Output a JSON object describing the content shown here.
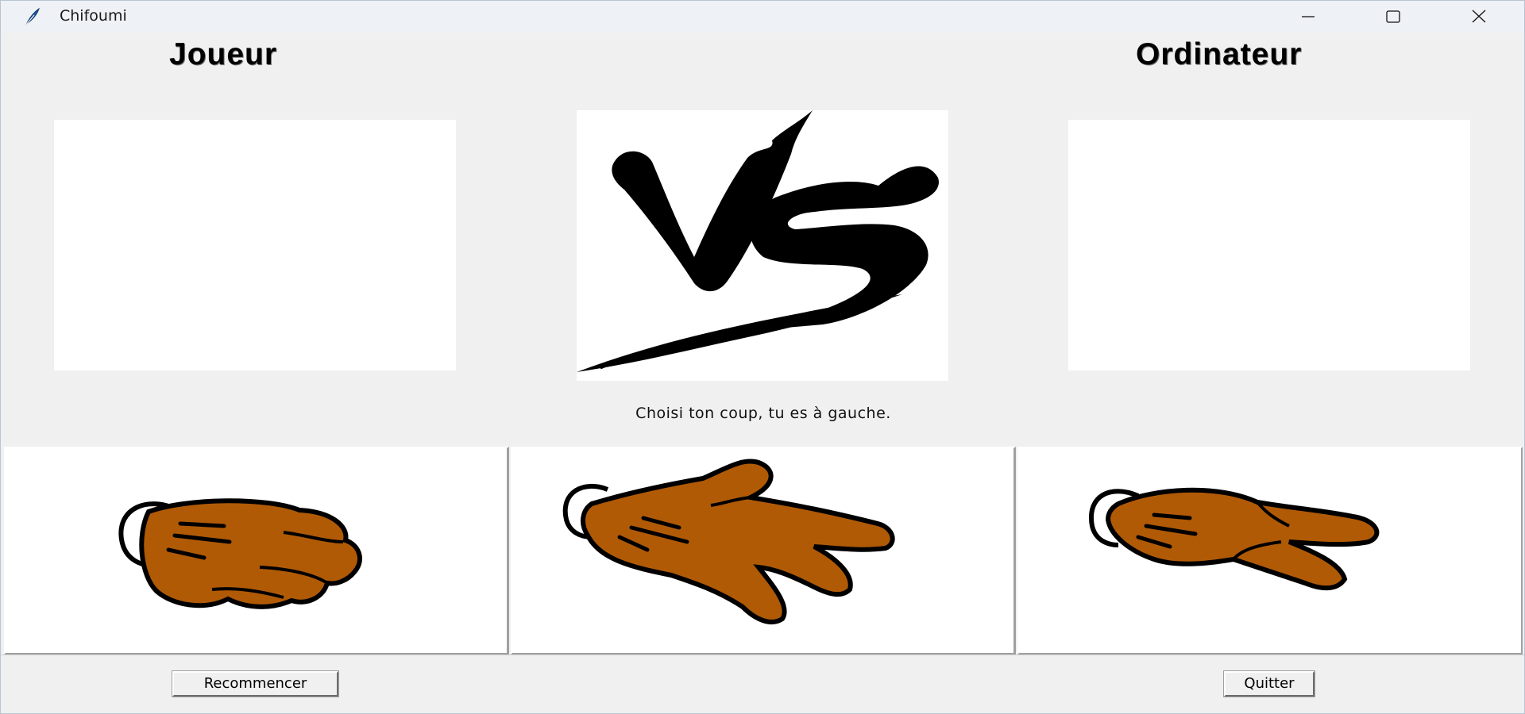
{
  "window": {
    "title": "Chifoumi",
    "icon": "feather-icon",
    "controls": [
      "minimize-icon",
      "maximize-icon",
      "close-icon"
    ]
  },
  "headings": {
    "player": "Joueur",
    "computer": "Ordinateur"
  },
  "status_text": "Choisi ton coup, tu es à gauche.",
  "choices": [
    {
      "name": "rock",
      "icon": "rock-hand-icon"
    },
    {
      "name": "paper",
      "icon": "paper-hand-icon"
    },
    {
      "name": "scissors",
      "icon": "scissors-hand-icon"
    }
  ],
  "buttons": {
    "restart": "Recommencer",
    "quit": "Quitter"
  },
  "colors": {
    "hand_fill": "#b05a06",
    "background": "#f0f0f0"
  }
}
